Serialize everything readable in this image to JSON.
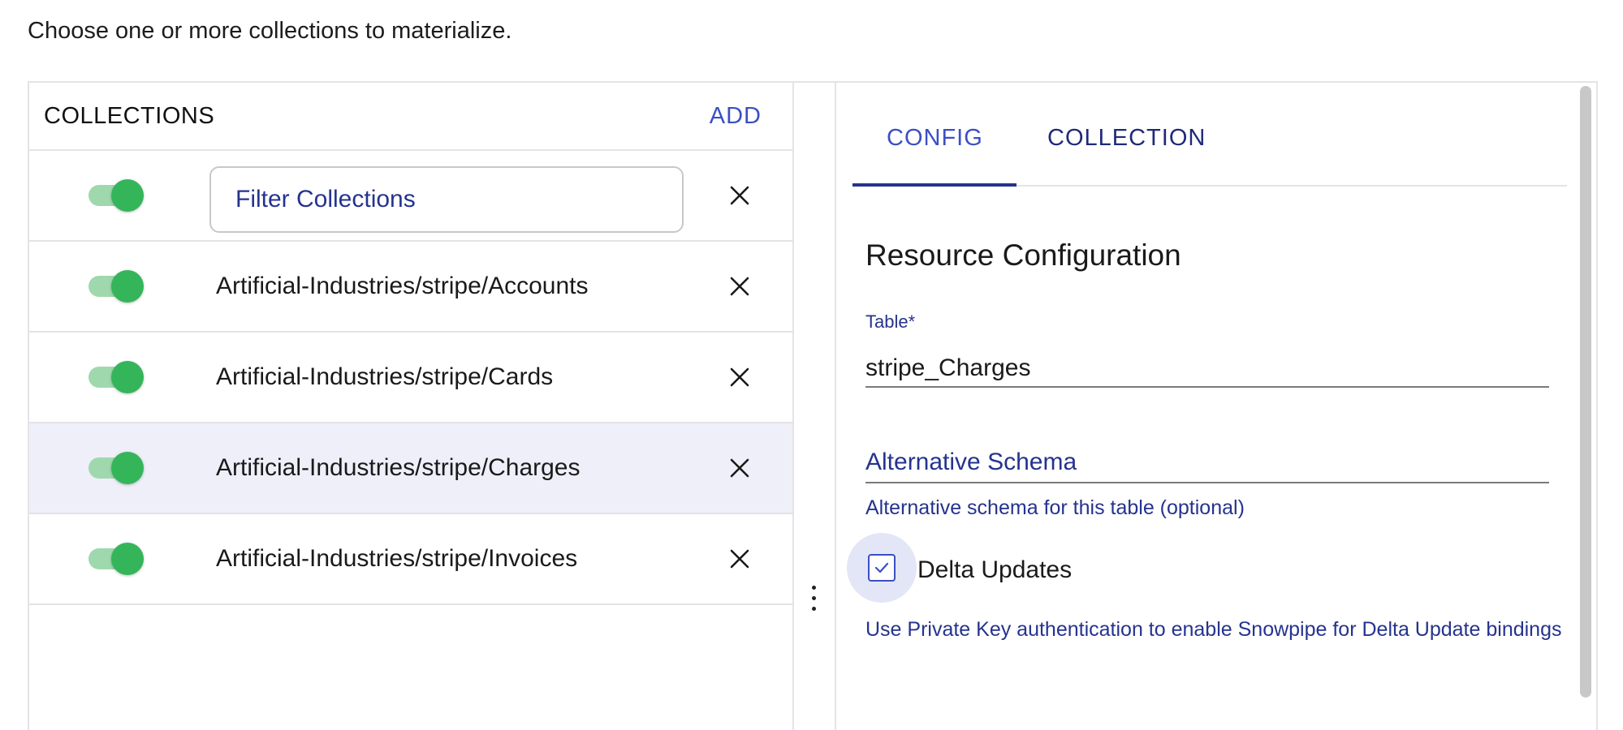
{
  "intro": "Choose one or more collections to materialize.",
  "collections_panel": {
    "title": "COLLECTIONS",
    "add_label": "ADD",
    "filter_placeholder": "Filter Collections",
    "items": [
      {
        "label": "Artificial-Industries/stripe/Accounts",
        "enabled": true,
        "selected": false
      },
      {
        "label": "Artificial-Industries/stripe/Cards",
        "enabled": true,
        "selected": false
      },
      {
        "label": "Artificial-Industries/stripe/Charges",
        "enabled": true,
        "selected": true
      },
      {
        "label": "Artificial-Industries/stripe/Invoices",
        "enabled": true,
        "selected": false
      }
    ]
  },
  "tabs": {
    "config": "CONFIG",
    "collection": "COLLECTION",
    "active": "config"
  },
  "resource_config": {
    "title": "Resource Configuration",
    "table_label": "Table",
    "table_required_marker": "*",
    "table_value": "stripe_Charges",
    "alt_schema_placeholder": "Alternative Schema",
    "alt_schema_helper": "Alternative schema for this table (optional)",
    "delta_updates_label": "Delta Updates",
    "delta_updates_checked": true,
    "delta_updates_helper": "Use Private Key authentication to enable Snowpipe for Delta Update bindings"
  },
  "colors": {
    "accent": "#3b4fc4",
    "toggle_on": "#34b55a",
    "selected_row": "#eeeff9"
  }
}
